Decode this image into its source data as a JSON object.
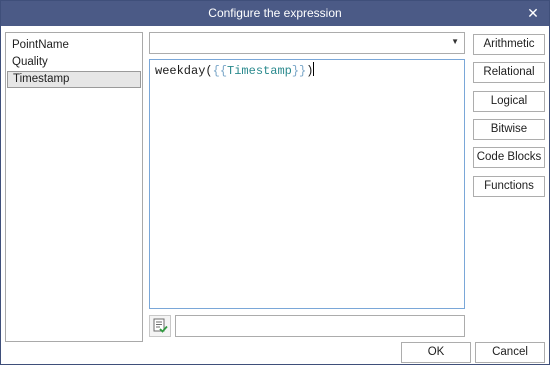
{
  "window": {
    "title": "Configure the expression",
    "close_glyph": "✕"
  },
  "fields": [
    {
      "label": "PointName",
      "selected": false
    },
    {
      "label": "Quality",
      "selected": false
    },
    {
      "label": "Timestamp",
      "selected": true
    }
  ],
  "function_combo": {
    "value": "",
    "arrow": "▼"
  },
  "expression": {
    "function": "weekday",
    "open_paren": "(",
    "open_braces": "{{",
    "parameter": "Timestamp",
    "close_braces": "}}",
    "close_paren": ")"
  },
  "operator_buttons": [
    {
      "label": "Arithmetic"
    },
    {
      "label": "Relational"
    },
    {
      "label": "Logical"
    },
    {
      "label": "Bitwise"
    },
    {
      "label": "Code Blocks"
    },
    {
      "label": "Functions"
    }
  ],
  "validation": {
    "icon": "validate-icon",
    "message": ""
  },
  "footer": {
    "ok_label": "OK",
    "cancel_label": "Cancel"
  },
  "colors": {
    "titlebar": "#4b5a86",
    "editor_border": "#7aa7d8",
    "parameter_text": "#2b8a8e",
    "brace_text": "#7aa6c8"
  }
}
